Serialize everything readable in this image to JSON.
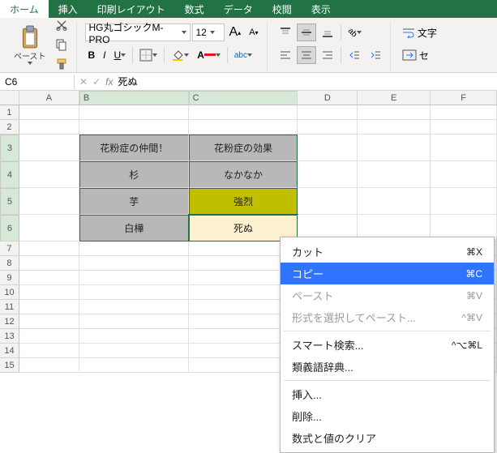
{
  "tabs": [
    "ホーム",
    "挿入",
    "印刷レイアウト",
    "数式",
    "データ",
    "校閲",
    "表示"
  ],
  "activeTab": 0,
  "toolbar": {
    "paste": "ペースト",
    "font": "HG丸ゴシックM-PRO",
    "size": "12",
    "bold": "B",
    "italic": "I",
    "underline": "U",
    "abc": "abc",
    "textGroup": "文字"
  },
  "nameBox": "C6",
  "fx": "fx",
  "formula": "死ぬ",
  "cols": [
    "A",
    "B",
    "C",
    "D",
    "E",
    "F"
  ],
  "rows": [
    "1",
    "2",
    "3",
    "4",
    "5",
    "6",
    "7",
    "8",
    "9",
    "10",
    "11",
    "12",
    "13",
    "14",
    "15"
  ],
  "table": {
    "r3": {
      "b": "花粉症の仲間！",
      "c": "花粉症の効果"
    },
    "r4": {
      "b": "杉",
      "c": "なかなか"
    },
    "r5": {
      "b": "芋",
      "c": "強烈"
    },
    "r6": {
      "b": "白樺",
      "c": "死ぬ"
    }
  },
  "menu": {
    "cut": {
      "label": "カット",
      "sc": "⌘X"
    },
    "copy": {
      "label": "コピー",
      "sc": "⌘C"
    },
    "paste": {
      "label": "ペースト",
      "sc": "⌘V"
    },
    "pasteSpecial": {
      "label": "形式を選択してペースト...",
      "sc": "^⌘V"
    },
    "smart": {
      "label": "スマート検索...",
      "sc": "^⌥⌘L"
    },
    "thesaurus": {
      "label": "類義語辞典...",
      "sc": ""
    },
    "insert": {
      "label": "挿入...",
      "sc": ""
    },
    "delete": {
      "label": "削除...",
      "sc": ""
    },
    "clear": {
      "label": "数式と値のクリア",
      "sc": ""
    }
  }
}
